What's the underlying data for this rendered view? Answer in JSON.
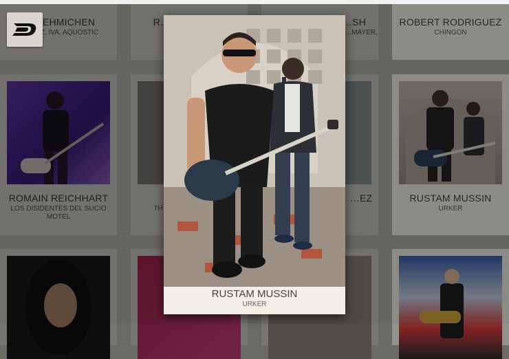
{
  "cards_top": [
    {
      "name": "…EHMICHEN",
      "band": "…ZZ, IVA, AQUOSTIC"
    },
    {
      "name": "R…",
      "band": ""
    },
    {
      "name": "…SH",
      "band": "…MAYER,"
    },
    {
      "name": "ROBERT RODRIGUEZ",
      "band": "CHINGON"
    }
  ],
  "cards_mid": [
    {
      "name": "ROMAIN REICHHART",
      "band": "LOS DISIDENTES DEL SUCIO MOTEL"
    },
    {
      "name": "",
      "band": "TH…"
    },
    {
      "name": "…EZ",
      "band": ""
    },
    {
      "name": "RUSTAM MUSSIN",
      "band": "URKER"
    }
  ],
  "modal": {
    "name": "RUSTAM MUSSIN",
    "band": "URKER"
  },
  "colors": {
    "card_bg": "#efece4",
    "overlay": "#6b6a64",
    "modal_bg": "#f2efe6"
  },
  "icons": {
    "logo": "d-letter-logo-icon"
  }
}
